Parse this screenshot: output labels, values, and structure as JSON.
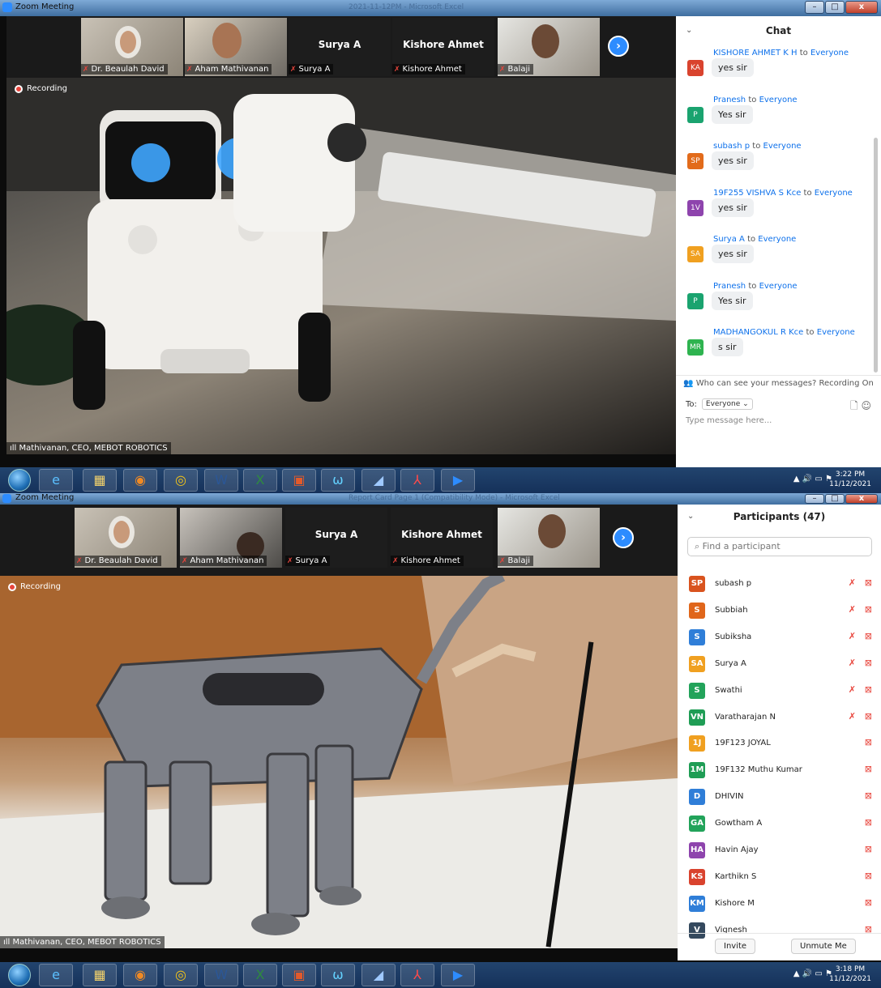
{
  "screens": [
    {
      "window_title": "Zoom Meeting",
      "title_center_faded": "2021-11-12PM - Microsoft Excel",
      "strip_names": [
        "Dr. Beaulah David",
        "Aham Mathivanan",
        "Surya A",
        "Kishore Ahmet",
        "Balaji"
      ],
      "tile_center_names": [
        "Surya A",
        "Kishore Ahmet"
      ],
      "recording_label": "Recording",
      "speaker_name": "Mathivanan, CEO, MEBOT ROBOTICS",
      "chat": {
        "header": "Chat",
        "messages": [
          {
            "sender": "KISHORE AHMET K H",
            "to": "to",
            "recipient": "Everyone",
            "initials": "KA",
            "color": "#d9432e",
            "text": "yes sir"
          },
          {
            "sender": "Pranesh",
            "to": "to",
            "recipient": "Everyone",
            "initials": "P",
            "color": "#1aa36f",
            "text": "Yes sir"
          },
          {
            "sender": "subash p",
            "to": "to",
            "recipient": "Everyone",
            "initials": "SP",
            "color": "#e26b1b",
            "text": "yes sir"
          },
          {
            "sender": "19F255 VISHVA S Kce",
            "to": "to",
            "recipient": "Everyone",
            "initials": "1V",
            "color": "#8e44ad",
            "text": "yes sir"
          },
          {
            "sender": "Surya A",
            "to": "to",
            "recipient": "Everyone",
            "initials": "SA",
            "color": "#f0a020",
            "text": "yes sir"
          },
          {
            "sender": "Pranesh",
            "to": "to",
            "recipient": "Everyone",
            "initials": "P",
            "color": "#1aa36f",
            "text": "Yes sir"
          },
          {
            "sender": "MADHANGOKUL R Kce",
            "to": "to",
            "recipient": "Everyone",
            "initials": "MR",
            "color": "#2eb34f",
            "text": "s sir"
          }
        ],
        "privacy_note": "Who can see your messages? Recording On",
        "to_label": "To:",
        "to_value": "Everyone",
        "input_placeholder": "Type message here..."
      },
      "clock": {
        "time": "3:22 PM",
        "date": "11/12/2021"
      }
    },
    {
      "window_title": "Zoom Meeting",
      "title_center_faded": "Report Card Page 1 (Compatibility Mode) - Microsoft Excel",
      "strip_names": [
        "Dr. Beaulah David",
        "Aham Mathivanan",
        "Surya A",
        "Kishore Ahmet",
        "Balaji"
      ],
      "tile_center_names": [
        "Surya A",
        "Kishore Ahmet"
      ],
      "recording_label": "Recording",
      "speaker_name": "Mathivanan, CEO, MEBOT ROBOTICS",
      "participants": {
        "header": "Participants (47)",
        "search_placeholder": "Find a participant",
        "list": [
          {
            "initials": "SP",
            "name": "subash p",
            "color": "#d9531e",
            "mic_muted": true
          },
          {
            "initials": "S",
            "name": "Subbiah",
            "color": "#e0661b",
            "mic_muted": true
          },
          {
            "initials": "S",
            "name": "Subiksha",
            "color": "#2f7ed8",
            "mic_muted": true
          },
          {
            "initials": "SA",
            "name": "Surya A",
            "color": "#f0a020",
            "mic_muted": true
          },
          {
            "initials": "S",
            "name": "Swathi",
            "color": "#22a35a",
            "mic_muted": true
          },
          {
            "initials": "VN",
            "name": "Varatharajan N",
            "color": "#1f9d55",
            "mic_muted": true
          },
          {
            "initials": "1J",
            "name": "19F123 JOYAL",
            "color": "#f0a020",
            "mic_muted": false
          },
          {
            "initials": "1M",
            "name": "19F132 Muthu Kumar",
            "color": "#1f9d55",
            "mic_muted": false
          },
          {
            "initials": "D",
            "name": "DHIVIN",
            "color": "#2f7ed8",
            "mic_muted": false
          },
          {
            "initials": "GA",
            "name": "Gowtham A",
            "color": "#22a35a",
            "mic_muted": false
          },
          {
            "initials": "HA",
            "name": "Havin Ajay",
            "color": "#8e44ad",
            "mic_muted": false
          },
          {
            "initials": "KS",
            "name": "Karthikn S",
            "color": "#d9432e",
            "mic_muted": false
          },
          {
            "initials": "KM",
            "name": "Kishore M",
            "color": "#2f7ed8",
            "mic_muted": false
          },
          {
            "initials": "V",
            "name": "Vignesh",
            "color": "#34495e",
            "mic_muted": false
          }
        ],
        "invite_label": "Invite",
        "unmute_label": "Unmute Me"
      },
      "clock": {
        "time": "3:18 PM",
        "date": "11/12/2021"
      }
    }
  ],
  "taskbar_icons": [
    "windows-start",
    "internet-explorer",
    "file-explorer",
    "media-player",
    "chrome",
    "word",
    "excel",
    "presentation",
    "webex",
    "generic-app",
    "acrobat",
    "zoom"
  ],
  "colors": {
    "zoom_blue": "#2d8cff",
    "muted_red": "#e8453c",
    "link_blue": "#0e71eb"
  }
}
